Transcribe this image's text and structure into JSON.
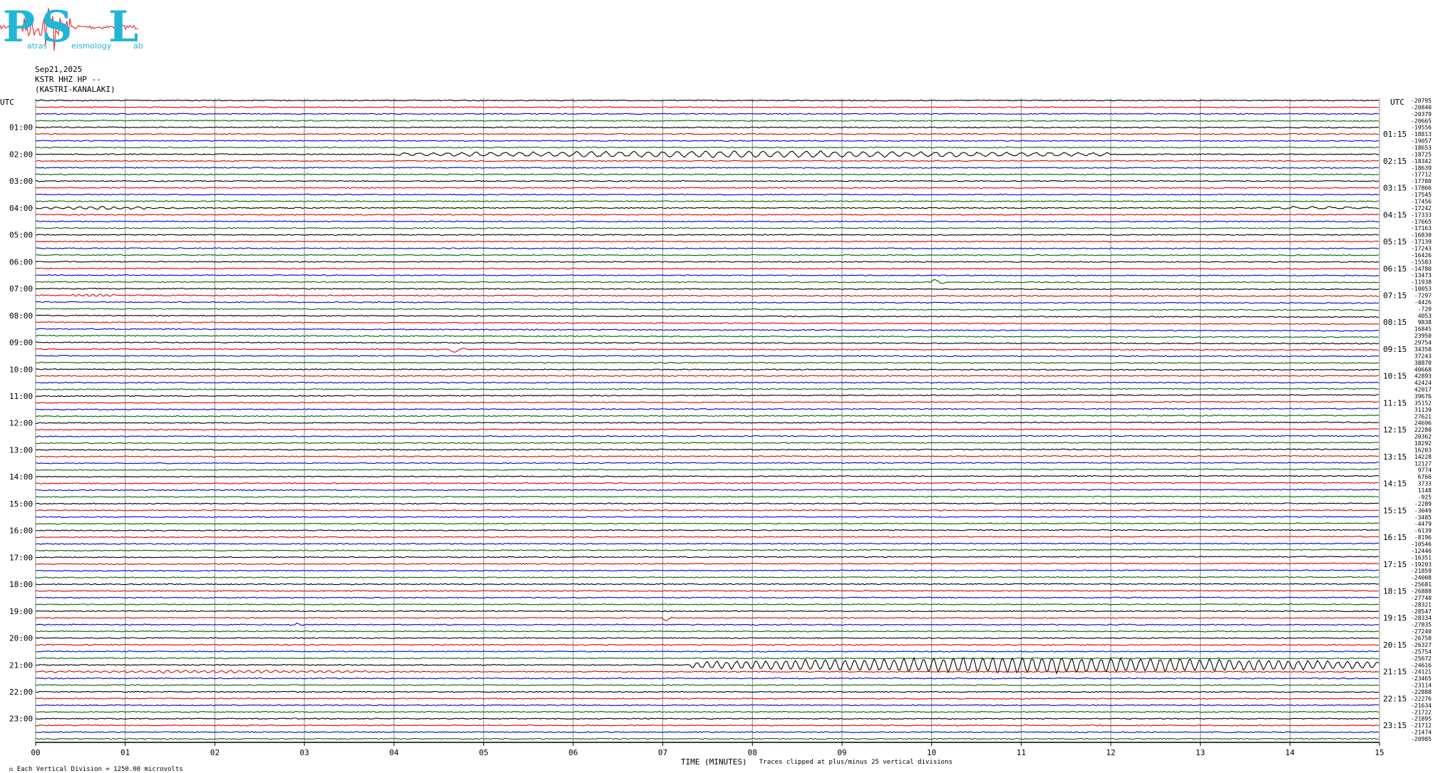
{
  "logo": {
    "letters": [
      "P",
      "S",
      "L"
    ],
    "small_words": [
      "atras",
      "eismology",
      "ab"
    ],
    "color": "#22b5d6",
    "trace_color": "#e8383d"
  },
  "header": {
    "date": "Sep21,2025",
    "station": "KSTR HHZ HP --",
    "location": "(KASTRI-KANALAKI)"
  },
  "footer": {
    "scale_note": "Each Vertical Division = 1250.00 microvolts",
    "clip_note": "Traces clipped at plus/minus 25 vertical divisions",
    "xlabel": "TIME (MINUTES)"
  },
  "chart_data": {
    "type": "line",
    "title": "",
    "xlabel": "TIME (MINUTES)",
    "ylabel": "UTC",
    "xlim": [
      0,
      15
    ],
    "x_ticks": [
      "00",
      "01",
      "02",
      "03",
      "04",
      "05",
      "06",
      "07",
      "08",
      "09",
      "10",
      "11",
      "12",
      "13",
      "14",
      "15"
    ],
    "left_axis_label": "UTC",
    "right_axis_label": "UTC",
    "left_hour_labels": [
      "01:00",
      "02:00",
      "03:00",
      "04:00",
      "05:00",
      "06:00",
      "07:00",
      "08:00",
      "09:00",
      "10:00",
      "11:00",
      "12:00",
      "13:00",
      "14:00",
      "15:00",
      "16:00",
      "17:00",
      "18:00",
      "19:00",
      "20:00",
      "21:00",
      "22:00",
      "23:00"
    ],
    "right_hour_labels": [
      "01:15",
      "02:15",
      "03:15",
      "04:15",
      "05:15",
      "06:15",
      "07:15",
      "08:15",
      "09:15",
      "10:15",
      "11:15",
      "12:15",
      "13:15",
      "14:15",
      "15:15",
      "16:15",
      "17:15",
      "18:15",
      "19:15",
      "20:15",
      "21:15",
      "22:15",
      "23:15"
    ],
    "trace_count": 96,
    "trace_minutes": 15,
    "trace_color_cycle": [
      "#000000",
      "#e00000",
      "#0000e0",
      "#006400"
    ],
    "grid": true,
    "trace_offsets": [
      -20795,
      -20840,
      -20379,
      -20665,
      -19556,
      -18813,
      -19057,
      -18653,
      -18725,
      -18342,
      -18639,
      -17712,
      -17780,
      -17866,
      -17545,
      -17456,
      -17242,
      -17333,
      -17665,
      -17163,
      -16830,
      -17139,
      -17243,
      -16426,
      -15583,
      -14780,
      -13473,
      -11938,
      -10053,
      -7297,
      -4426,
      -720,
      4053,
      9838,
      16845,
      23950,
      29754,
      34358,
      37243,
      38870,
      40668,
      42893,
      42424,
      42017,
      39676,
      35152,
      31139,
      27621,
      24696,
      22280,
      20362,
      18292,
      16203,
      14228,
      12127,
      9774,
      6766,
      3733,
      1148,
      -925,
      -2289,
      -3049,
      -3485,
      -4479,
      -6139,
      -8196,
      -10546,
      -12446,
      -16351,
      -19203,
      -21859,
      -24008,
      -25681,
      -26888,
      -27740,
      -28321,
      -28547,
      -28334,
      -27835,
      -27240,
      -26758,
      -26327,
      -25754,
      -25672,
      -24616,
      -24121,
      -23465,
      -23114,
      -22888,
      -22276,
      -21634,
      -21722,
      -21895,
      -21712,
      -21474,
      -20985
    ],
    "events": [
      {
        "trace": 8,
        "start": 4.0,
        "end": 12.0,
        "amp": 5,
        "period": 0.16
      },
      {
        "trace": 16,
        "start": 0.0,
        "end": 1.6,
        "amp": 2,
        "period": 0.13
      },
      {
        "trace": 16,
        "start": 13.5,
        "end": 15.0,
        "amp": 2,
        "period": 0.2
      },
      {
        "trace": 27,
        "start": 10.0,
        "end": 10.15,
        "amp": 5,
        "period": 0.015
      },
      {
        "trace": 29,
        "start": 0.4,
        "end": 0.9,
        "amp": 2,
        "period": 0.02
      },
      {
        "trace": 37,
        "start": 4.6,
        "end": 4.8,
        "amp": 5,
        "period": 0.015
      },
      {
        "trace": 73,
        "start": 1.3,
        "end": 1.4,
        "amp": 2,
        "period": 0.015
      },
      {
        "trace": 77,
        "start": 7.0,
        "end": 7.1,
        "amp": 5,
        "period": 0.015
      },
      {
        "trace": 78,
        "start": 2.9,
        "end": 2.98,
        "amp": 4,
        "period": 0.015
      },
      {
        "trace": 84,
        "start": 7.3,
        "end": 15.0,
        "amp": 12,
        "period": 0.11
      },
      {
        "trace": 85,
        "start": 0.0,
        "end": 4.0,
        "amp": 2,
        "period": 0.1
      }
    ]
  }
}
